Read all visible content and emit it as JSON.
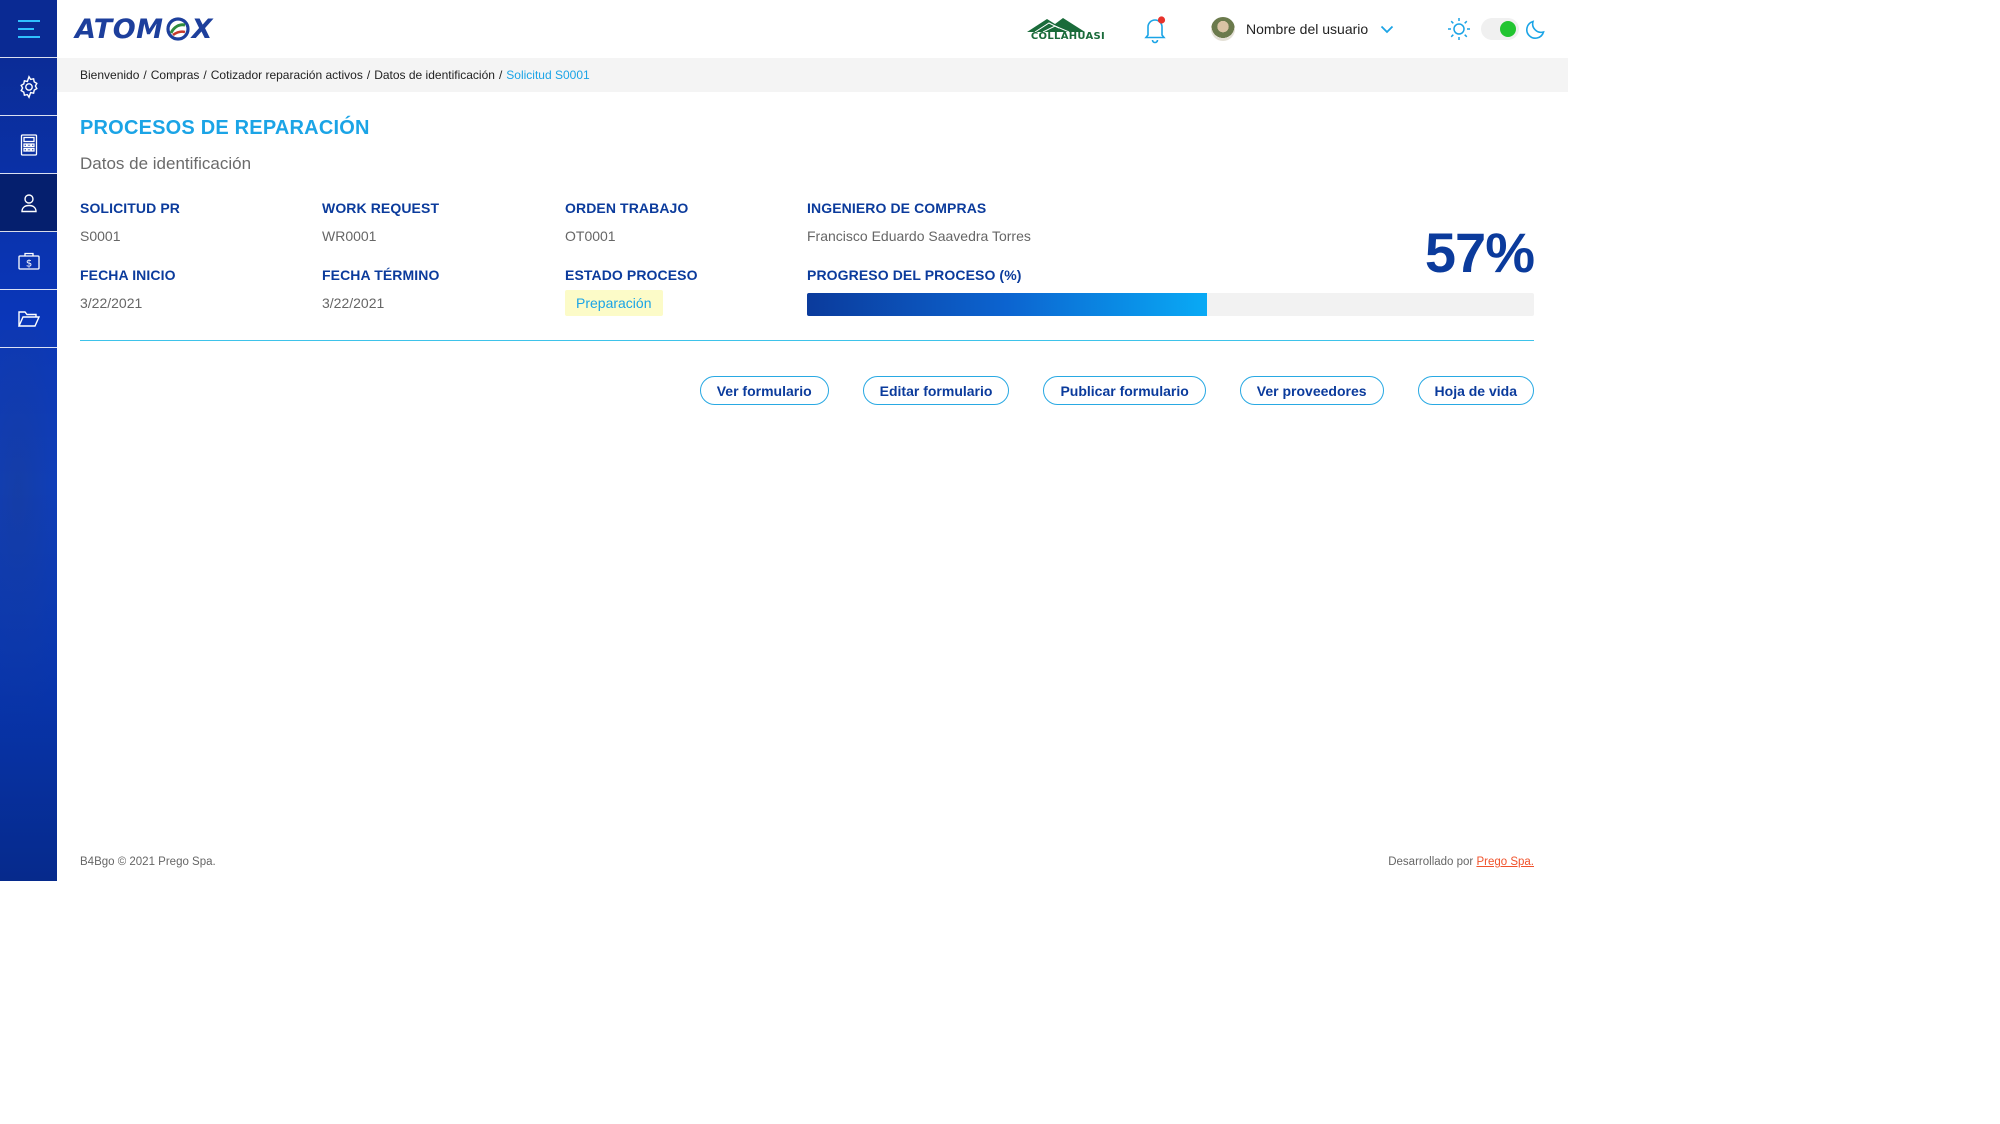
{
  "app": {
    "logo_text_left": "ATOM",
    "logo_text_right": "X",
    "client_logo_text": "COLLAHUASI"
  },
  "sidebar": {
    "items": [
      {
        "icon": "menu-icon"
      },
      {
        "icon": "gear-icon"
      },
      {
        "icon": "calculator-icon"
      },
      {
        "icon": "user-icon"
      },
      {
        "icon": "money-icon"
      },
      {
        "icon": "folder-icon"
      }
    ],
    "active_index": 3
  },
  "header": {
    "user_name": "Nombre del usuario",
    "notification_dot_color": "#e8322b",
    "theme_toggle_on": true
  },
  "breadcrumb": [
    {
      "label": "Bienvenido"
    },
    {
      "label": "Compras"
    },
    {
      "label": "Cotizador reparación activos"
    },
    {
      "label": "Datos de identificación"
    },
    {
      "label": "Solicitud S0001"
    }
  ],
  "page": {
    "title": "PROCESOS DE REPARACIÓN",
    "subtitle": "Datos de identificación"
  },
  "fields": {
    "solicitud_pr": {
      "label": "SOLICITUD PR",
      "value": "S0001"
    },
    "work_request": {
      "label": "WORK REQUEST",
      "value": "WR0001"
    },
    "orden_trabajo": {
      "label": "ORDEN TRABAJO",
      "value": "OT0001"
    },
    "ingeniero": {
      "label": "INGENIERO DE COMPRAS",
      "value": "Francisco Eduardo Saavedra Torres"
    },
    "fecha_inicio": {
      "label": "FECHA INICIO",
      "value": "3/22/2021"
    },
    "fecha_termino": {
      "label": "FECHA TÉRMINO",
      "value": "3/22/2021"
    },
    "estado_proceso": {
      "label": "ESTADO PROCESO",
      "value": "Preparación"
    },
    "progreso": {
      "label": "PROGRESO DEL PROCESO (%)",
      "display": "57%",
      "value": 0.55
    }
  },
  "actions": [
    {
      "label": "Ver formulario"
    },
    {
      "label": "Editar formulario"
    },
    {
      "label": "Publicar formulario"
    },
    {
      "label": "Ver proveedores"
    },
    {
      "label": "Hoja de vida"
    }
  ],
  "footer": {
    "left": "B4Bgo © 2021 Prego Spa.",
    "right_prefix": "Desarrollado por",
    "right_link": "Prego Spa."
  },
  "colors": {
    "primary": "#0b3b9c",
    "accent": "#1ba4e6",
    "status_badge_bg": "#fcfbc8",
    "toggle_knob": "#22c531",
    "footer_link": "#f0522b"
  }
}
